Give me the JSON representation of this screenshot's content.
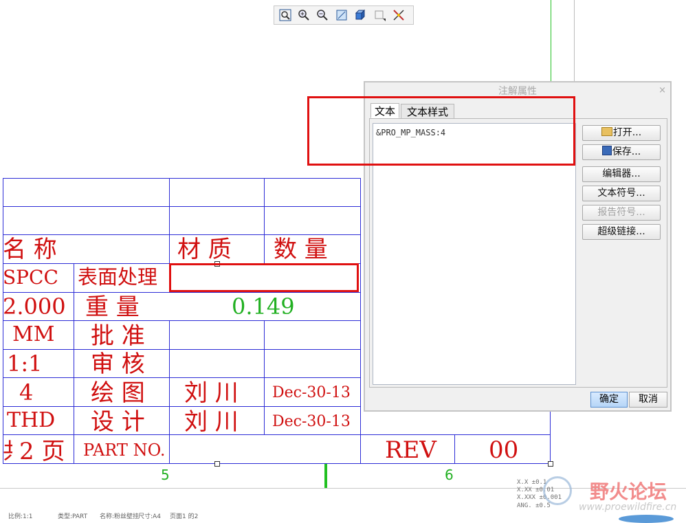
{
  "toolbar": {
    "icons": [
      "zoom-fit-icon",
      "zoom-in-icon",
      "zoom-out-icon",
      "refit-icon",
      "shaded-icon",
      "view-manager-icon",
      "repaint-icon"
    ]
  },
  "title_block": {
    "header_name": "名       称",
    "header_material": "材  质",
    "header_qty": "数   量",
    "material_value": "SPCC",
    "surface_label": "表面处理",
    "weight_left": "2.000",
    "weight_label": "重  量",
    "weight_value": "0.149",
    "unit": "MM",
    "approve_label": "批 准",
    "scale": "1:1",
    "review_label": "审 核",
    "sheet_count": "4",
    "draw_label": "绘 图",
    "draw_name": "刘 川",
    "draw_date": "Dec-30-13",
    "std": "THD",
    "design_label": "设 计",
    "design_name": "刘 川",
    "design_date": "Dec-30-13",
    "page_text": "2 页",
    "page_prefix": "共",
    "part_no_label": "PART NO.",
    "rev_label": "REV",
    "rev_value": "00",
    "zone_5": "5",
    "zone_6": "6"
  },
  "dialog": {
    "title": "注解属性",
    "close": "×",
    "tab_text": "文本",
    "tab_style": "文本样式",
    "text_value": "&PRO_MP_MASS:4",
    "btn_open": "打开...",
    "btn_save": "保存...",
    "btn_editor": "编辑器...",
    "btn_text_symbol": "文本符号...",
    "btn_report_symbol": "报告符号...",
    "btn_hyperlink": "超级链接...",
    "btn_ok": "确定",
    "btn_cancel": "取消"
  },
  "tolerance": {
    "l1": "X.X    ±0.1",
    "l2": "X.XX   ±0.01",
    "l3": "X.XXX  ±0.001",
    "l4": "ANG.   ±0.5"
  },
  "watermark": {
    "cn": "野火论坛",
    "url": "www.proewildfire.cn"
  },
  "status_bar": {
    "scale": "比例:1:1",
    "type": "类型:PART",
    "name": "名称:粉丝壁挂",
    "size": "尺寸:A4",
    "page": "页面1 的2"
  },
  "colors": {
    "drawing_text": "#d01010",
    "drawing_lines": "#2b2bd6",
    "param_text": "#21b021",
    "highlight": "#e01010"
  }
}
